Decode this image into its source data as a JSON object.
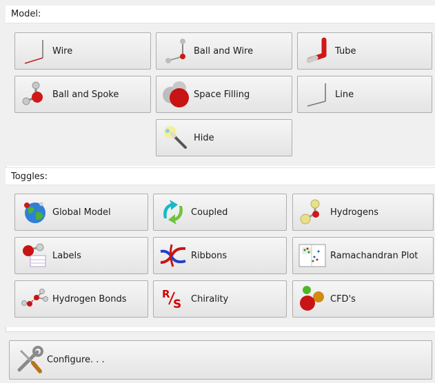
{
  "model": {
    "title": "Model:",
    "buttons": {
      "wire": "Wire",
      "ball_and_wire": "Ball and Wire",
      "tube": "Tube",
      "ball_and_spoke": "Ball and Spoke",
      "space_filling": "Space Filling",
      "line": "Line",
      "hide": "Hide"
    }
  },
  "toggles": {
    "title": "Toggles:",
    "buttons": {
      "global_model": "Global Model",
      "coupled": "Coupled",
      "hydrogens": "Hydrogens",
      "labels": "Labels",
      "ribbons": "Ribbons",
      "ramachandran_plot": "Ramachandran Plot",
      "hydrogen_bonds": "Hydrogen Bonds",
      "chirality": "Chirality",
      "cfds": "CFD's"
    }
  },
  "configure": {
    "label": "Configure. . ."
  },
  "icons": {
    "wire": "wire-icon",
    "ball_and_wire": "ball-and-wire-icon",
    "tube": "tube-icon",
    "ball_and_spoke": "ball-and-spoke-icon",
    "space_filling": "space-filling-icon",
    "line": "line-icon",
    "hide": "magic-wand-icon",
    "global_model": "globe-icon",
    "coupled": "coupled-arrows-icon",
    "hydrogens": "hydrogen-atoms-icon",
    "labels": "labels-icon",
    "ribbons": "ribbon-helix-icon",
    "ramachandran_plot": "ramachandran-plot-icon",
    "hydrogen_bonds": "hydrogen-bond-icon",
    "chirality": "chirality-rs-icon",
    "cfds": "cfd-spheres-icon",
    "configure": "wrench-screwdriver-icon"
  },
  "colors": {
    "oxygen_red": "#d01818",
    "hydrogen_white": "#d8d8d8",
    "carbon_gray": "#555555",
    "chirality_red": "#d40000",
    "panel_bg": "#f0f0f0"
  }
}
